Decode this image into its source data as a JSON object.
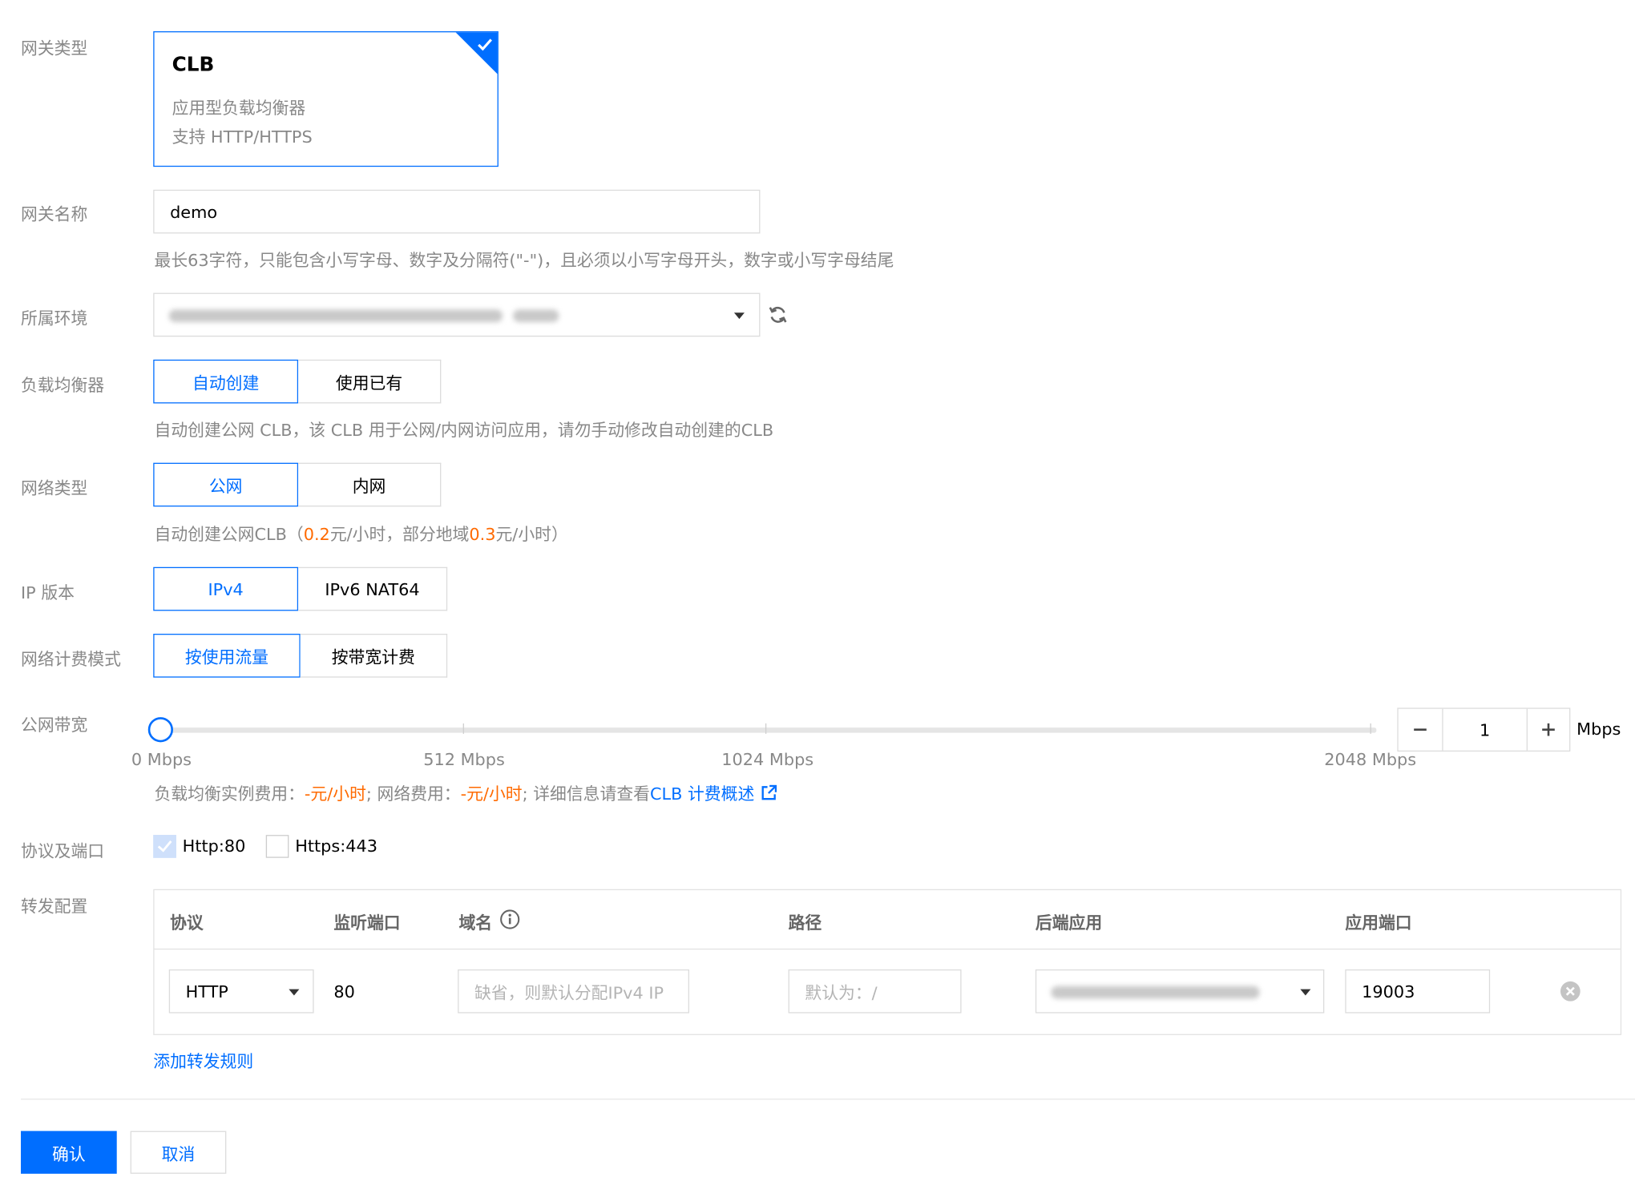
{
  "gateway_type": {
    "label": "网关类型",
    "card": {
      "title": "CLB",
      "line1": "应用型负载均衡器",
      "line2": "支持 HTTP/HTTPS",
      "selected": true
    }
  },
  "gateway_name": {
    "label": "网关名称",
    "value": "demo",
    "help": "最长63字符，只能包含小写字母、数字及分隔符(\"-\")，且必须以小写字母开头，数字或小写字母结尾"
  },
  "environment": {
    "label": "所属环境",
    "value_obscured": true
  },
  "load_balancer": {
    "label": "负载均衡器",
    "options": [
      "自动创建",
      "使用已有"
    ],
    "selected": "自动创建",
    "help": "自动创建公网 CLB，该 CLB 用于公网/内网访问应用，请勿手动修改自动创建的CLB"
  },
  "network_type": {
    "label": "网络类型",
    "options": [
      "公网",
      "内网"
    ],
    "selected": "公网",
    "help_prefix": "自动创建公网CLB（",
    "price1": "0.2",
    "help_mid": "元/小时，部分地域",
    "price2": "0.3",
    "help_suffix": "元/小时）"
  },
  "ip_version": {
    "label": "IP 版本",
    "options": [
      "IPv4",
      "IPv6 NAT64"
    ],
    "selected": "IPv4"
  },
  "billing_mode": {
    "label": "网络计费模式",
    "options": [
      "按使用流量",
      "按带宽计费"
    ],
    "selected": "按使用流量"
  },
  "bandwidth": {
    "label": "公网带宽",
    "ticks": [
      "0 Mbps",
      "512 Mbps",
      "1024 Mbps",
      "2048 Mbps"
    ],
    "value": "1",
    "unit": "Mbps",
    "slider_fraction": 0,
    "fee_label1": "负载均衡实例费用：",
    "fee_value1": "-元/小时",
    "fee_sep": "; 网络费用：",
    "fee_value2": "-元/小时",
    "fee_detail": "; 详细信息请查看",
    "fee_link": "CLB 计费概述"
  },
  "protocols": {
    "label": "协议及端口",
    "items": [
      {
        "label": "Http:80",
        "checked": true
      },
      {
        "label": "Https:443",
        "checked": false
      }
    ]
  },
  "forwarding": {
    "label": "转发配置",
    "headers": [
      "协议",
      "监听端口",
      "域名",
      "路径",
      "后端应用",
      "应用端口"
    ],
    "row": {
      "protocol": "HTTP",
      "port": "80",
      "domain_placeholder": "缺省，则默认分配IPv4 IP",
      "path_placeholder": "默认为：/",
      "backend_obscured": true,
      "app_port": "19003"
    },
    "add_rule": "添加转发规则"
  },
  "actions": {
    "confirm": "确认",
    "cancel": "取消"
  },
  "colors": {
    "primary": "#006eff",
    "price": "#ff6a00",
    "label": "#888888",
    "border": "#dcdcdc"
  }
}
